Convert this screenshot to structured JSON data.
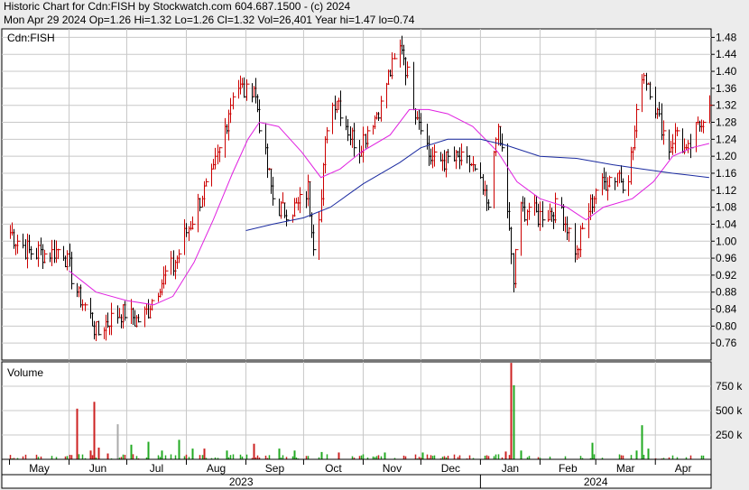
{
  "header": {
    "line1": "Historic Chart for Cdn:FISH by Stockwatch.com 604.687.1500 - (c) 2024",
    "line2": "Mon Apr 29 2024  Op=1.26  Hi=1.32  Lo=1.26  Cl=1.32  Vol=26,401  Year hi=1.47  lo=0.74"
  },
  "colors": {
    "up_bar": "#cc0000",
    "down_bar": "#000000",
    "ma_short": "#e020e0",
    "ma_long": "#1a2aa0",
    "vol_up": "#22aa22",
    "vol_down": "#cc2222",
    "vol_flat": "#aaaaaa",
    "grid": "#c8c8c8"
  },
  "chart_data": [
    {
      "type": "ohlc",
      "series_label": "Cdn:FISH",
      "ylim": [
        0.72,
        1.5
      ],
      "y_ticks": [
        1.48,
        1.44,
        1.4,
        1.36,
        1.32,
        1.28,
        1.24,
        1.2,
        1.16,
        1.12,
        1.08,
        1.04,
        1.0,
        0.96,
        0.92,
        0.88,
        0.84,
        0.8,
        0.76
      ],
      "y_tick_labels": [
        "1.48",
        "1.44",
        "1.40",
        "1.36",
        "1.32",
        "1.28",
        "1.24",
        "1.20",
        "1.16",
        "1.12",
        "1.08",
        "1.04",
        "1.00",
        "0.96",
        "0.92",
        "0.88",
        "0.84",
        "0.80",
        "0.76"
      ],
      "x_months": [
        "May",
        "Jun",
        "Jul",
        "Aug",
        "Sep",
        "Oct",
        "Nov",
        "Dec",
        "Jan",
        "Feb",
        "Mar",
        "Apr"
      ],
      "x_years": [
        "2023",
        "2024"
      ],
      "anchors": [
        [
          "2023-05-01",
          1.02
        ],
        [
          "2023-05-10",
          0.98
        ],
        [
          "2023-05-20",
          0.97
        ],
        [
          "2023-05-29",
          0.98
        ],
        [
          "2023-06-05",
          0.88
        ],
        [
          "2023-06-12",
          0.82
        ],
        [
          "2023-06-16",
          0.78
        ],
        [
          "2023-06-22",
          0.82
        ],
        [
          "2023-06-30",
          0.83
        ],
        [
          "2023-07-06",
          0.81
        ],
        [
          "2023-07-12",
          0.84
        ],
        [
          "2023-07-18",
          0.9
        ],
        [
          "2023-07-26",
          0.95
        ],
        [
          "2023-08-01",
          1.02
        ],
        [
          "2023-08-08",
          1.1
        ],
        [
          "2023-08-15",
          1.16
        ],
        [
          "2023-08-22",
          1.28
        ],
        [
          "2023-08-26",
          1.38
        ],
        [
          "2023-09-01",
          1.35
        ],
        [
          "2023-09-05",
          1.37
        ],
        [
          "2023-09-10",
          1.22
        ],
        [
          "2023-09-15",
          1.1
        ],
        [
          "2023-09-20",
          1.07
        ],
        [
          "2023-09-28",
          1.08
        ],
        [
          "2023-10-03",
          1.12
        ],
        [
          "2023-10-06",
          1.0
        ],
        [
          "2023-10-10",
          1.1
        ],
        [
          "2023-10-13",
          1.28
        ],
        [
          "2023-10-18",
          1.34
        ],
        [
          "2023-10-24",
          1.26
        ],
        [
          "2023-10-30",
          1.22
        ],
        [
          "2023-11-05",
          1.28
        ],
        [
          "2023-11-10",
          1.32
        ],
        [
          "2023-11-15",
          1.4
        ],
        [
          "2023-11-21",
          1.46
        ],
        [
          "2023-11-26",
          1.34
        ],
        [
          "2023-12-01",
          1.28
        ],
        [
          "2023-12-05",
          1.2
        ],
        [
          "2023-12-10",
          1.19
        ],
        [
          "2023-12-20",
          1.19
        ],
        [
          "2023-12-27",
          1.18
        ],
        [
          "2024-01-02",
          1.12
        ],
        [
          "2024-01-05",
          1.06
        ],
        [
          "2024-01-09",
          1.26
        ],
        [
          "2024-01-13",
          1.2
        ],
        [
          "2024-01-18",
          0.9
        ],
        [
          "2024-01-20",
          1.06
        ],
        [
          "2024-01-25",
          1.08
        ],
        [
          "2024-01-31",
          1.06
        ],
        [
          "2024-02-06",
          1.07
        ],
        [
          "2024-02-12",
          1.08
        ],
        [
          "2024-02-16",
          1.02
        ],
        [
          "2024-02-20",
          0.97
        ],
        [
          "2024-02-25",
          1.06
        ],
        [
          "2024-03-01",
          1.12
        ],
        [
          "2024-03-06",
          1.14
        ],
        [
          "2024-03-12",
          1.16
        ],
        [
          "2024-03-17",
          1.14
        ],
        [
          "2024-03-20",
          1.22
        ],
        [
          "2024-03-25",
          1.4
        ],
        [
          "2024-03-28",
          1.38
        ],
        [
          "2024-04-02",
          1.3
        ],
        [
          "2024-04-08",
          1.22
        ],
        [
          "2024-04-12",
          1.26
        ],
        [
          "2024-04-17",
          1.2
        ],
        [
          "2024-04-22",
          1.26
        ],
        [
          "2024-04-29",
          1.32
        ]
      ],
      "ma_short": [
        [
          "2023-06-01",
          0.93
        ],
        [
          "2023-06-15",
          0.88
        ],
        [
          "2023-07-01",
          0.86
        ],
        [
          "2023-07-15",
          0.85
        ],
        [
          "2023-07-25",
          0.87
        ],
        [
          "2023-08-05",
          0.95
        ],
        [
          "2023-08-15",
          1.05
        ],
        [
          "2023-08-25",
          1.16
        ],
        [
          "2023-09-02",
          1.24
        ],
        [
          "2023-09-08",
          1.28
        ],
        [
          "2023-09-18",
          1.27
        ],
        [
          "2023-09-30",
          1.21
        ],
        [
          "2023-10-10",
          1.15
        ],
        [
          "2023-10-20",
          1.17
        ],
        [
          "2023-10-31",
          1.21
        ],
        [
          "2023-11-15",
          1.25
        ],
        [
          "2023-11-25",
          1.31
        ],
        [
          "2023-12-05",
          1.31
        ],
        [
          "2023-12-15",
          1.3
        ],
        [
          "2023-12-28",
          1.27
        ],
        [
          "2024-01-10",
          1.21
        ],
        [
          "2024-01-20",
          1.14
        ],
        [
          "2024-02-01",
          1.1
        ],
        [
          "2024-02-15",
          1.08
        ],
        [
          "2024-02-25",
          1.05
        ],
        [
          "2024-03-05",
          1.08
        ],
        [
          "2024-03-20",
          1.1
        ],
        [
          "2024-03-31",
          1.14
        ],
        [
          "2024-04-10",
          1.2
        ],
        [
          "2024-04-20",
          1.22
        ],
        [
          "2024-04-29",
          1.23
        ]
      ],
      "ma_long": [
        [
          "2023-09-01",
          1.025
        ],
        [
          "2023-09-15",
          1.04
        ],
        [
          "2023-10-01",
          1.055
        ],
        [
          "2023-10-15",
          1.08
        ],
        [
          "2023-11-01",
          1.135
        ],
        [
          "2023-11-20",
          1.185
        ],
        [
          "2023-12-01",
          1.22
        ],
        [
          "2023-12-15",
          1.24
        ],
        [
          "2024-01-01",
          1.24
        ],
        [
          "2024-01-15",
          1.225
        ],
        [
          "2024-02-01",
          1.2
        ],
        [
          "2024-02-20",
          1.195
        ],
        [
          "2024-03-10",
          1.18
        ],
        [
          "2024-03-25",
          1.17
        ],
        [
          "2024-04-10",
          1.16
        ],
        [
          "2024-04-29",
          1.15
        ]
      ]
    },
    {
      "type": "bar",
      "series_label": "Volume",
      "ylim": [
        0,
        1000000
      ],
      "y_ticks": [
        250000,
        500000,
        750000
      ],
      "y_tick_labels": [
        "250 k",
        "500 k",
        "750 k"
      ],
      "spikes": [
        [
          "2023-06-05",
          520000,
          "down"
        ],
        [
          "2023-06-12",
          90000,
          "down"
        ],
        [
          "2023-06-14",
          590000,
          "down"
        ],
        [
          "2023-06-16",
          120000,
          "down"
        ],
        [
          "2023-06-21",
          60000,
          "down"
        ],
        [
          "2023-06-26",
          360000,
          "flat"
        ],
        [
          "2023-07-03",
          150000,
          "up"
        ],
        [
          "2023-07-12",
          180000,
          "up"
        ],
        [
          "2023-07-19",
          90000,
          "up"
        ],
        [
          "2023-07-28",
          200000,
          "up"
        ],
        [
          "2023-08-04",
          110000,
          "up"
        ],
        [
          "2023-08-10",
          110000,
          "down"
        ],
        [
          "2023-08-22",
          90000,
          "up"
        ],
        [
          "2023-09-05",
          160000,
          "down"
        ],
        [
          "2023-09-18",
          110000,
          "up"
        ],
        [
          "2023-09-26",
          90000,
          "up"
        ],
        [
          "2023-10-10",
          75000,
          "up"
        ],
        [
          "2023-10-19",
          70000,
          "down"
        ],
        [
          "2023-11-12",
          70000,
          "up"
        ],
        [
          "2023-12-02",
          70000,
          "up"
        ],
        [
          "2024-01-14",
          80000,
          "down"
        ],
        [
          "2024-01-17",
          990000,
          "down"
        ],
        [
          "2024-01-18",
          760000,
          "up"
        ],
        [
          "2024-01-22",
          90000,
          "up"
        ],
        [
          "2024-02-28",
          170000,
          "up"
        ],
        [
          "2024-03-22",
          90000,
          "up"
        ],
        [
          "2024-03-25",
          350000,
          "up"
        ],
        [
          "2024-03-28",
          110000,
          "up"
        ]
      ]
    }
  ]
}
